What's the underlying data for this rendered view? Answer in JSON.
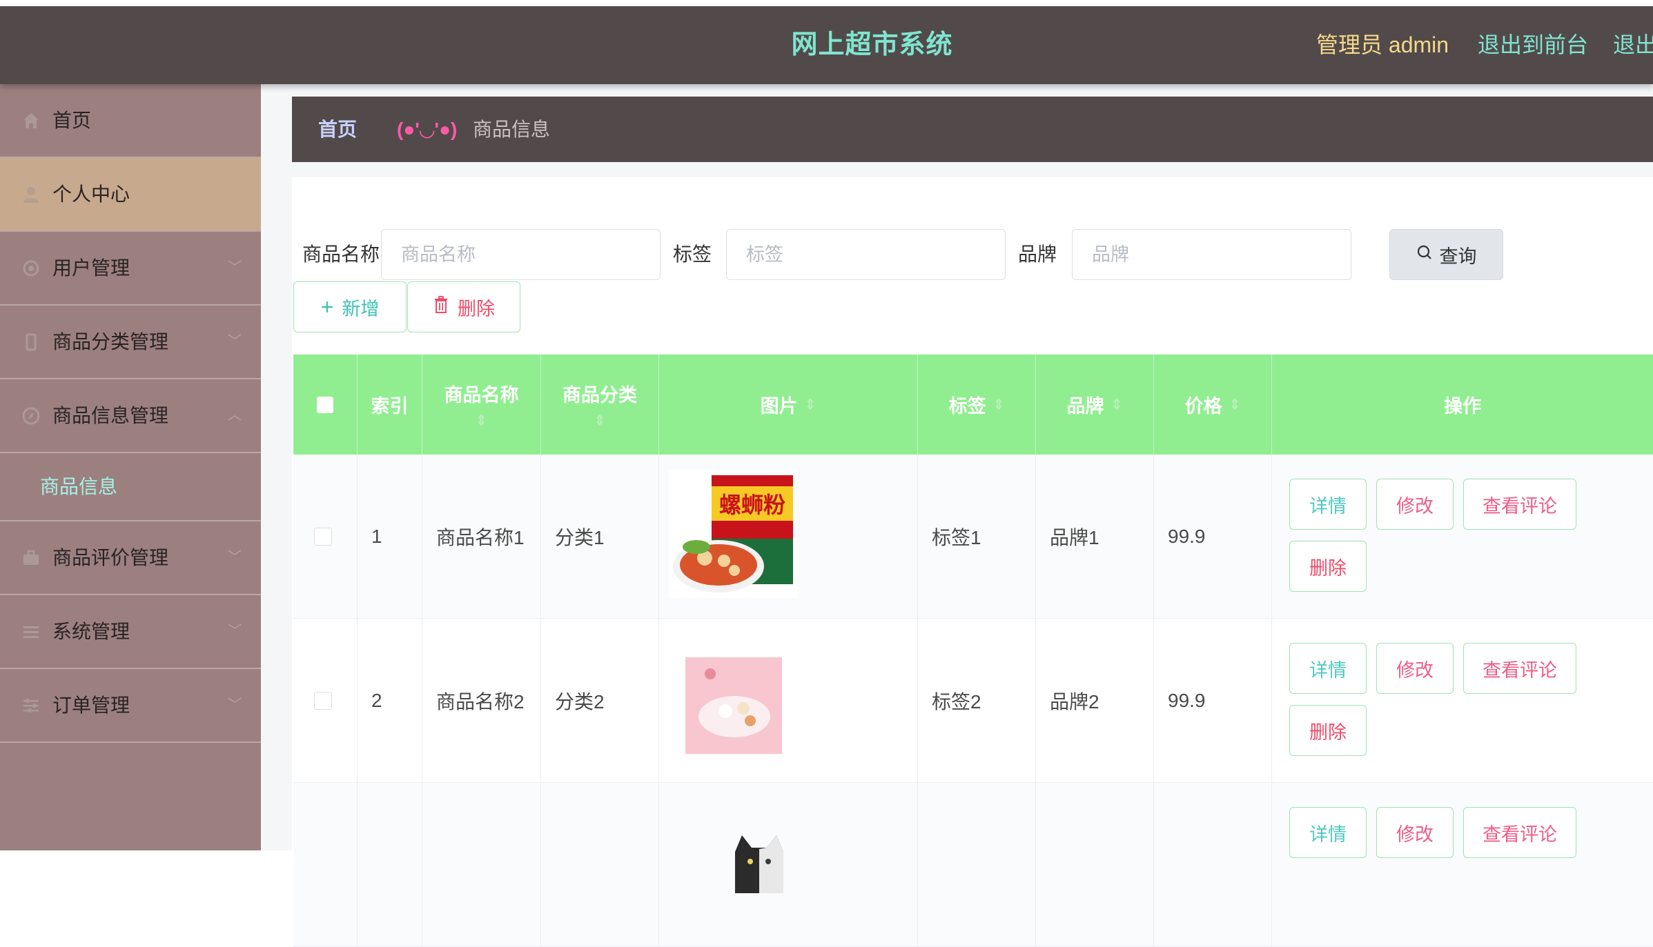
{
  "header": {
    "title": "网上超市系统",
    "admin_label": "管理员 admin",
    "to_front": "退出到前台",
    "logout": "退出"
  },
  "sidebar": {
    "items": [
      {
        "label": "首页",
        "icon": "home-icon"
      },
      {
        "label": "个人中心",
        "icon": "user-icon"
      },
      {
        "label": "用户管理",
        "icon": "gear-icon"
      },
      {
        "label": "商品分类管理",
        "icon": "phone-icon"
      },
      {
        "label": "商品信息管理",
        "icon": "compass-icon"
      },
      {
        "label": "商品信息",
        "icon": ""
      },
      {
        "label": "商品评价管理",
        "icon": "briefcase-icon"
      },
      {
        "label": "系统管理",
        "icon": "menu-icon"
      },
      {
        "label": "订单管理",
        "icon": "sliders-icon"
      }
    ]
  },
  "breadcrumb": {
    "home": "首页",
    "separator": "(●'◡'●)",
    "current": "商品信息"
  },
  "filters": {
    "name_label": "商品名称",
    "name_placeholder": "商品名称",
    "tag_label": "标签",
    "tag_placeholder": "标签",
    "brand_label": "品牌",
    "brand_placeholder": "品牌",
    "query_label": "查询"
  },
  "actions": {
    "add_label": "新增",
    "delete_label": "删除"
  },
  "table": {
    "headers": {
      "index": "索引",
      "name": "商品名称",
      "category": "商品分类",
      "image": "图片",
      "tag": "标签",
      "brand": "品牌",
      "price": "价格",
      "ops": "操作"
    },
    "rows": [
      {
        "index": "1",
        "name": "商品名称1",
        "category": "分类1",
        "image": "螺蛳粉",
        "tag": "标签1",
        "brand": "品牌1",
        "price": "99.9"
      },
      {
        "index": "2",
        "name": "商品名称2",
        "category": "分类2",
        "image": "",
        "tag": "标签2",
        "brand": "品牌2",
        "price": "99.9"
      },
      {
        "index": "",
        "name": "",
        "category": "",
        "image": "",
        "tag": "",
        "brand": "",
        "price": ""
      }
    ],
    "op_labels": {
      "detail": "详情",
      "edit": "修改",
      "reviews": "查看评论",
      "delete": "删除"
    }
  },
  "colors": {
    "topbar": "#524a4a",
    "sidebar": "#9c8080",
    "sidebar_active": "#c7a98d",
    "table_header": "#90ee90",
    "accent_teal": "#7fe5d0"
  }
}
